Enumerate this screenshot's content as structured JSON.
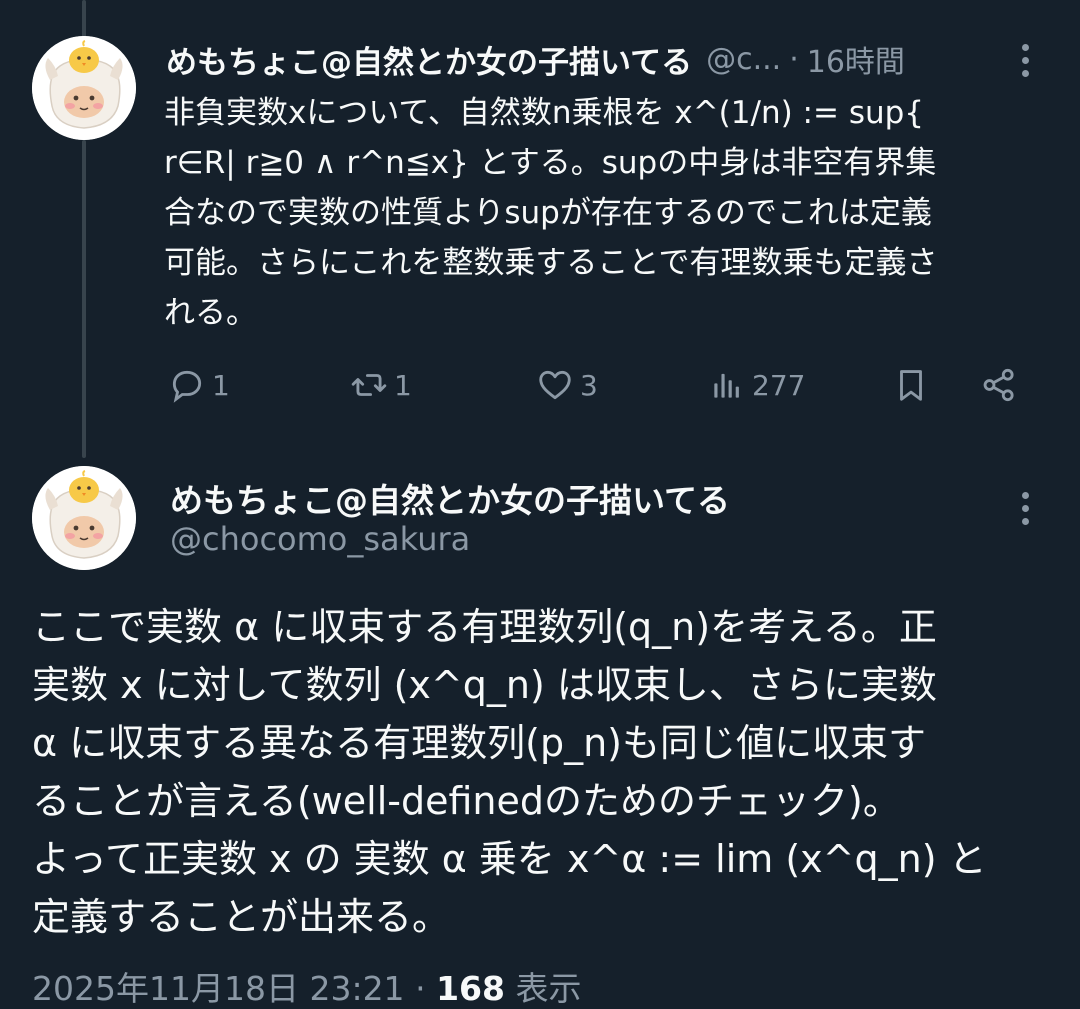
{
  "tweet1": {
    "display_name": "めもちょこ@自然とか女の子描いてる",
    "handle": "@c...",
    "separator": "·",
    "time": "16時間",
    "body_lines": [
      "非負実数xについて、自然数n乗根を x^(1/n) :=  sup{",
      "r∈R| r≧0 ∧ r^n≦x} とする。supの中身は非空有界集",
      "合なので実数の性質よりsupが存在するのでこれは定義",
      "可能。さらにこれを整数乗することで有理数乗も定義さ",
      "れる。"
    ],
    "actions": {
      "reply_count": "1",
      "retweet_count": "1",
      "like_count": "3",
      "view_count": "277"
    }
  },
  "tweet2": {
    "display_name": "めもちょこ@自然とか女の子描いてる",
    "handle": "@chocomo_sakura",
    "body_lines": [
      "ここで実数 α に収束する有理数列(q_n)を考える。正",
      "実数 x に対して数列 (x^q_n) は収束し、さらに実数",
      "α に収束する異なる有理数列(p_n)も同じ値に収束す",
      "ることが言える(well-definedのためのチェック)。",
      "よって正実数 x の 実数 α 乗を x^α := lim (x^q_n) と",
      "定義することが出来る。"
    ],
    "timestamp": "2025年11月18日 23:21",
    "meta_separator": "·",
    "views_count": "168",
    "views_label": "表示"
  },
  "colors": {
    "background": "#15202b",
    "text": "#f7f9f9",
    "muted": "#8b98a5",
    "thread_line": "#38444d"
  },
  "icons": [
    "reply-icon",
    "retweet-icon",
    "like-icon",
    "views-icon",
    "bookmark-icon",
    "share-icon",
    "more-icon"
  ]
}
